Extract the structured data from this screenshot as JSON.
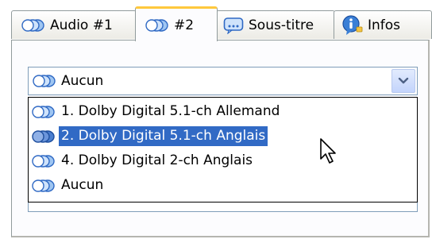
{
  "tabs": [
    {
      "label": "Audio #1",
      "icon": "speaker-icon",
      "active": false
    },
    {
      "label": "#2",
      "icon": "speaker-icon",
      "active": true
    },
    {
      "label": "Sous-titre",
      "icon": "subtitle-icon",
      "active": false
    },
    {
      "label": "Infos",
      "icon": "info-icon",
      "active": false
    }
  ],
  "combo": {
    "selected": "Aucun",
    "icon": "speaker-icon",
    "arrow_icon": "chevron-down-icon"
  },
  "dropdown": {
    "options": [
      {
        "label": "1. Dolby Digital 5.1-ch Allemand",
        "highlighted": false
      },
      {
        "label": "2. Dolby Digital 5.1-ch Anglais",
        "highlighted": true
      },
      {
        "label": "4. Dolby Digital 2-ch Anglais",
        "highlighted": false
      },
      {
        "label": "Aucun",
        "highlighted": false
      }
    ]
  },
  "colors": {
    "selection": "#316ac5",
    "active_tab_accent": "#ffc83c",
    "border": "#919b9c",
    "combo_border": "#7f9db9"
  }
}
